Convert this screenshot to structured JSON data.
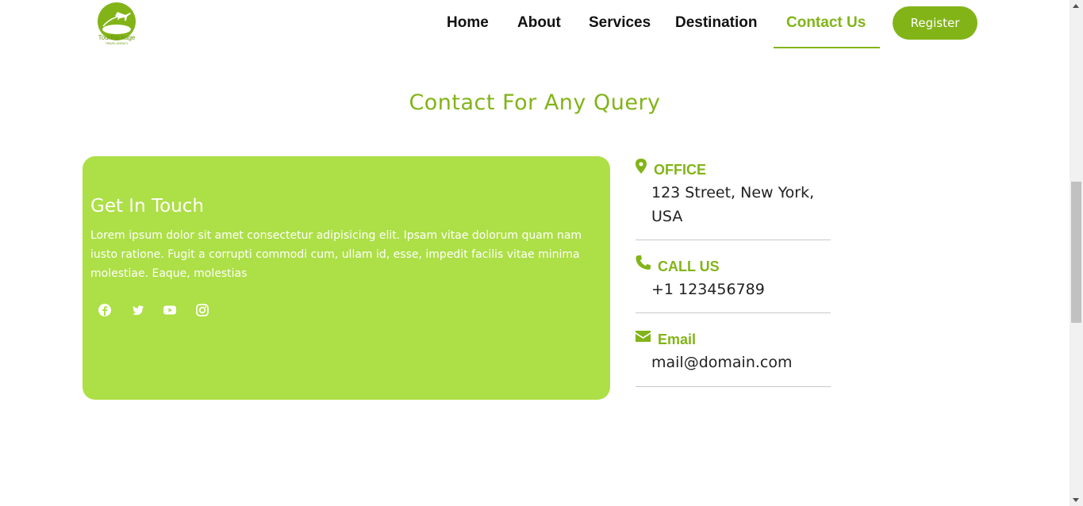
{
  "brand": {
    "name": "TourBackage",
    "tagline": "TRAVEL AGENCY"
  },
  "nav": {
    "items": [
      {
        "label": "Home"
      },
      {
        "label": "About"
      },
      {
        "label": "Services"
      },
      {
        "label": "Destination"
      },
      {
        "label": "Contact Us",
        "active": true
      }
    ],
    "register_label": "Register"
  },
  "section": {
    "title": "Contact For Any Query"
  },
  "card": {
    "title": "Get In Touch",
    "text": "Lorem ipsum dolor sit amet consectetur adipisicing elit. Ipsam vitae dolorum quam nam iusto ratione. Fugit a corrupti commodi cum, ullam id, esse, impedit facilis vitae minima molestiae. Eaque, molestias",
    "social": [
      "facebook-icon",
      "twitter-icon",
      "youtube-icon",
      "instagram-icon"
    ]
  },
  "contact": {
    "office": {
      "label": "OFFICE",
      "line1": "123 Street, New York,",
      "line2": "USA"
    },
    "call": {
      "label": "CALL US",
      "value": "+1 123456789"
    },
    "email": {
      "label": "Email",
      "value": "mail@domain.com"
    }
  },
  "colors": {
    "accent": "#82b418",
    "card": "#addf46"
  }
}
